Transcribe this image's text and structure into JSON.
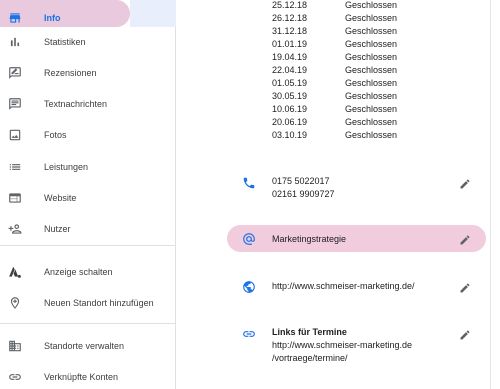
{
  "sidebar": {
    "items": [
      {
        "label": "Info",
        "icon": "storefront-icon",
        "active": true
      },
      {
        "label": "Statistiken",
        "icon": "bar-chart-icon"
      },
      {
        "label": "Rezensionen",
        "icon": "review-icon"
      },
      {
        "label": "Textnachrichten",
        "icon": "message-icon"
      },
      {
        "label": "Fotos",
        "icon": "photos-icon"
      },
      {
        "label": "Leistungen",
        "icon": "list-icon"
      },
      {
        "label": "Website",
        "icon": "website-icon"
      },
      {
        "label": "Nutzer",
        "icon": "add-person-icon"
      },
      {
        "label": "Anzeige schalten",
        "icon": "ads-icon"
      },
      {
        "label": "Neuen Standort hinzufügen",
        "icon": "add-location-icon"
      },
      {
        "label": "Standorte verwalten",
        "icon": "buildings-icon"
      },
      {
        "label": "Verknüpfte Konten",
        "icon": "link-icon"
      }
    ]
  },
  "hours": [
    {
      "date": "25.12.18",
      "status": "Geschlossen"
    },
    {
      "date": "26.12.18",
      "status": "Geschlossen"
    },
    {
      "date": "31.12.18",
      "status": "Geschlossen"
    },
    {
      "date": "01.01.19",
      "status": "Geschlossen"
    },
    {
      "date": "19.04.19",
      "status": "Geschlossen"
    },
    {
      "date": "22.04.19",
      "status": "Geschlossen"
    },
    {
      "date": "01.05.19",
      "status": "Geschlossen"
    },
    {
      "date": "30.05.19",
      "status": "Geschlossen"
    },
    {
      "date": "10.06.19",
      "status": "Geschlossen"
    },
    {
      "date": "20.06.19",
      "status": "Geschlossen"
    },
    {
      "date": "03.10.19",
      "status": "Geschlossen"
    }
  ],
  "phone": {
    "primary": "0175 5022017",
    "secondary": "02161 9909727"
  },
  "category": {
    "label": "Marketingstrategie"
  },
  "website": {
    "url": "http://www.schmeiser-marketing.de/"
  },
  "links": {
    "title": "Links für Termine",
    "line1": "http://www.schmeiser-marketing.de",
    "line2": "/vortraege/termine/"
  },
  "colors": {
    "accent": "#1a73e8",
    "highlight": "#f1ccdd",
    "icon": "#5f6368"
  }
}
